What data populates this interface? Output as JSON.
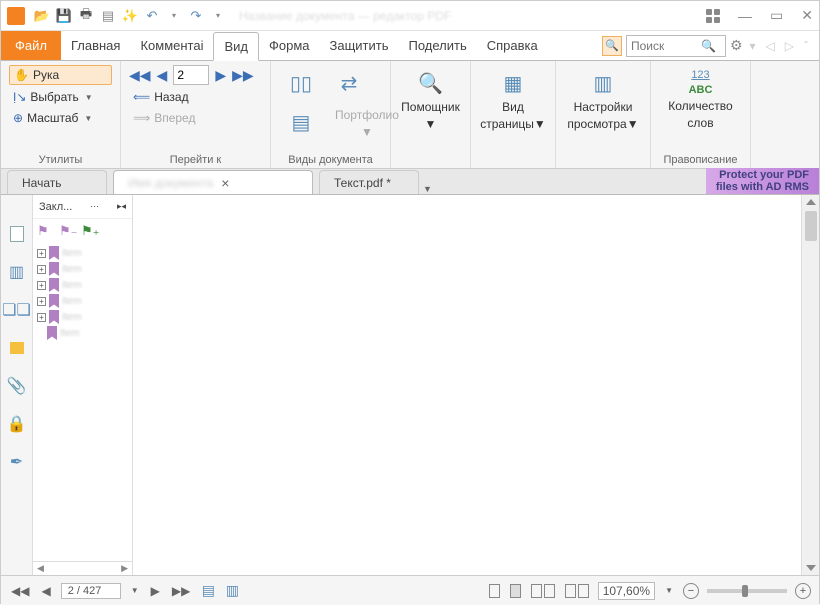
{
  "quickaccess": {
    "undo_dd": "▾"
  },
  "menu": {
    "file": "Файл",
    "home": "Главная",
    "comment": "Комментаі",
    "view": "Вид",
    "form": "Форма",
    "protect": "Защитить",
    "share": "Поделить",
    "help": "Справка"
  },
  "search": {
    "placeholder": "Поиск"
  },
  "ribbon": {
    "utilities": {
      "hand": "Рука",
      "select": "Выбрать",
      "zoom": "Масштаб",
      "group": "Утилиты"
    },
    "goto": {
      "page": "2",
      "back": "Назад",
      "forward": "Вперед",
      "group": "Перейти к"
    },
    "docview": {
      "portfolio": "Портфолио",
      "group": "Виды документа"
    },
    "assistant": {
      "label": "Помощник"
    },
    "pageview": {
      "label1": "Вид",
      "label2": "страницы"
    },
    "viewsettings": {
      "label1": "Настройки",
      "label2": "просмотра"
    },
    "spelling": {
      "top": "123",
      "abc": "ABC",
      "label1": "Количество",
      "label2": "слов",
      "group": "Правописание"
    }
  },
  "tabs": {
    "start": "Начать",
    "doc2": "Текст.pdf *"
  },
  "banner": {
    "line1": "Protect your PDF",
    "line2": "files with AD RMS"
  },
  "sidebar": {
    "title": "Закл...",
    "arrow": "▸◂"
  },
  "status": {
    "page": "2 / 427",
    "zoom": "107,60%"
  }
}
